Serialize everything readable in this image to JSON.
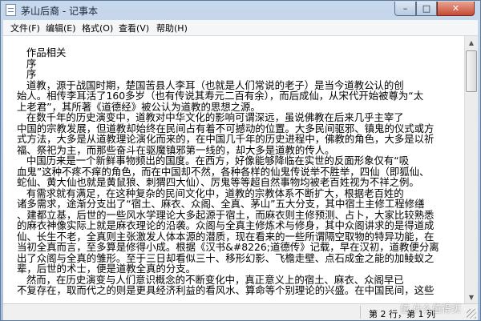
{
  "window": {
    "title": "茅山后裔 - 记事本",
    "buttons": {
      "minimize": "–",
      "maximize": "□",
      "close": "✕"
    }
  },
  "menu": [
    "文件(F)",
    "编辑(E)",
    "格式(O)",
    "查看(V)",
    "帮助(H)"
  ],
  "document": {
    "lines": [
      "   作品相关",
      "   序",
      "   序",
      "   道教，源于战国时期，楚国苦县人李耳（也就是人们常说的老子）是当今道教公认的创",
      "始人。相传李耳活了160多岁（也有传说其寿元二百有余），而后成仙，从宋代开始被尊为“太",
      "上老君”，其所著《道德经》被公认为道教的思想之源。",
      "   在数千年的历史演变中，道教对中华文化的影响可谓深远，虽说佛教在后来几乎主宰了",
      "中国的宗教发展，但道教却始终在民间占有着不可撼动的位置。大多民间驱邪、镇鬼的仪式或方",
      "式方法，大多是从道教理论演化而来的，在中国几千年的历史进程中，佛教的角色，大多是以祈",
      "福、祭祀为主，而那些奋斗在驱魔镇邪第一线的，却大多是道教的传人。",
      "   中国历来是一个新鲜事物频出的国度。在西方，好像能够降临在实世的反面形象仅有“吸",
      "血鬼”这种不疼不痒的角色，而在中国却不然，各种各样的仙鬼传说举不胜举，四仙（即狐仙、",
      "蛇仙、黄大仙也就是黄鼠狼、刺猬四大仙）、厉鬼等等超自然事物均被老百姓视为不祥之例。",
      "   有需求就有满足，在这种复杂的民间文化中，道教的宗教体系不断扩大，根据老百姓的",
      "诸多需求，途渐分支出了“宿土、麻衣、众阁、全真、茅山”五大分支，其中宿土主修工程修缮",
      "、建都立基，后世的一些风水学理论大多起源于宿土，而麻衣则主修预测、占卜，大家比较熟悉",
      "的麻衣神像实际上就是麻衣理论的沿袭。众阁与全真主修炼术与修身，其中众阁讲求的是得道成",
      "仙、长生不老，全真则主张激发人体本源的潜质，现在看来的一些所谓隔空取物的特异功能，在",
      "当初全真而言，至多算是修得小成。根据《汉书&#8226;道德传》记载，早在汉初，道教便分离",
      "出了众阁与全真的雏形。至于三日却看似三十、移形幻影、飞檐走壁、点石成金之能的加鲮蚁之",
      "辈，后世的术士，便是道教全真的分支。",
      "   然而，在历史演变与人们意识概念的不断变化中，真正意义上的宿土、麻衣、众阁早已",
      "不复存在，取而代之的则是更具经济利益的看风水、算命等个别理论的兴盛。在中国民间，这些"
    ]
  },
  "statusbar": {
    "position": "第 2 行，第 1 列"
  },
  "watermark": "值 什么值得买"
}
